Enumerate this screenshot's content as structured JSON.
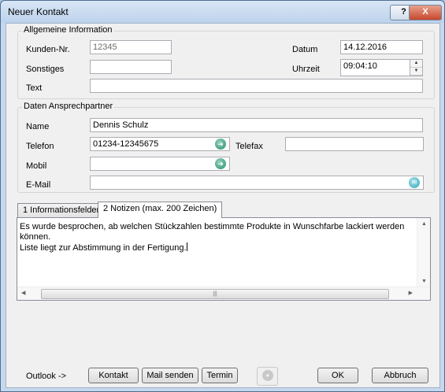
{
  "window": {
    "title": "Neuer Kontakt",
    "help_glyph": "?",
    "close_glyph": "X"
  },
  "general": {
    "legend": "Allgemeine Information",
    "kundennr_label": "Kunden-Nr.",
    "kundennr_value": "12345",
    "sonstiges_label": "Sonstiges",
    "sonstiges_value": "",
    "text_label": "Text",
    "text_value": "",
    "datum_label": "Datum",
    "datum_value": "14.12.2016",
    "uhrzeit_label": "Uhrzeit",
    "uhrzeit_value": "09:04:10"
  },
  "contact": {
    "legend": "Daten Ansprechpartner",
    "name_label": "Name",
    "name_value": "Dennis Schulz",
    "telefon_label": "Telefon",
    "telefon_value": "01234-12345675",
    "telefax_label": "Telefax",
    "telefax_value": "",
    "mobil_label": "Mobil",
    "mobil_value": "",
    "email_label": "E-Mail",
    "email_value": ""
  },
  "tabs": [
    {
      "label": "1 Informationsfelder",
      "active": false
    },
    {
      "label": "2 Notizen (max. 200 Zeichen)",
      "active": true
    }
  ],
  "notes": {
    "text": "Es wurde besprochen, ab welchen Stückzahlen bestimmte Produkte in Wunschfarbe lackiert werden\nkönnen.\nListe liegt zur Abstimmung in der Fertigung."
  },
  "footer": {
    "outlook_label": "Outlook ->",
    "kontakt": "Kontakt",
    "mail_senden": "Mail senden",
    "termin": "Termin",
    "ok": "OK",
    "abbruch": "Abbruch"
  },
  "icons": {
    "go": "arrow-right-circle-icon",
    "mail": "mail-circle-icon"
  }
}
